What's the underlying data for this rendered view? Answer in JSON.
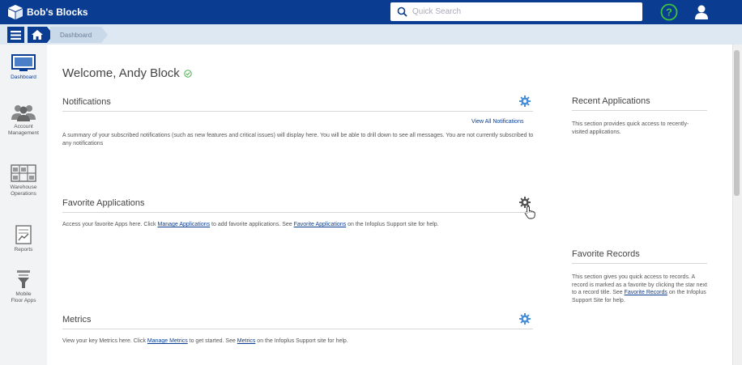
{
  "app": {
    "brand_name": "Bob's Blocks"
  },
  "header": {
    "search_placeholder": "Quick Search",
    "help_icon": "help-circle-icon",
    "user_icon": "user-icon"
  },
  "breadcrumb": {
    "items": [
      "Dashboard"
    ]
  },
  "sidebar": {
    "items": [
      {
        "label": "Dashboard",
        "icon": "dashboard-icon",
        "active": true
      },
      {
        "label": "Account Management",
        "icon": "users-icon"
      },
      {
        "label": "Warehouse Operations",
        "icon": "warehouse-icon"
      },
      {
        "label": "Reports",
        "icon": "report-icon"
      },
      {
        "label": "Mobile Floor Apps",
        "icon": "mobile-floor-icon"
      }
    ]
  },
  "main": {
    "welcome": "Welcome, Andy Block",
    "notifications": {
      "title": "Notifications",
      "view_all": "View All Notifications",
      "text": "A summary of your subscribed notifications (such as new features and critical issues) will display here. You will be able to drill down to see all messages. You are not currently subscribed to any notifications"
    },
    "favorite_apps": {
      "title": "Favorite Applications",
      "text_1": "Access your favorite Apps here. Click ",
      "link_1": "Manage Applications",
      "text_2": " to add favorite applications. See ",
      "link_2": "Favorite Applications",
      "text_3": " on the Infoplus Support site for help."
    },
    "metrics": {
      "title": "Metrics",
      "text_1": "View your key Metrics here. Click ",
      "link_1": "Manage Metrics",
      "text_2": " to get started. See ",
      "link_2": "Metrics",
      "text_3": " on the Infoplus Support site for help."
    }
  },
  "right": {
    "recent": {
      "title": "Recent Applications",
      "text": "This section provides quick access to recently-visited applications."
    },
    "favorite_records": {
      "title": "Favorite Records",
      "text_1": "This section gives you quick access to records. A record is marked as a favorite by clicking the star next to a record title. See ",
      "link": "Favorite Records",
      "text_2": " on the Infoplus Support Site for help."
    }
  },
  "colors": {
    "brand": "#0a3d91",
    "accent_gear": "#4a90d9",
    "success": "#2ca02c"
  }
}
